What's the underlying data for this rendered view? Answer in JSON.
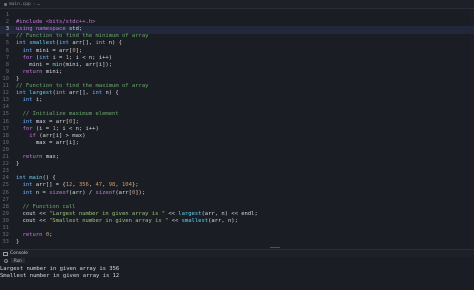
{
  "breadcrumb": {
    "file": "main.cpp",
    "separator": "›",
    "trail": "…"
  },
  "editor": {
    "active_line": 3,
    "lines": [
      {
        "n": "1",
        "tokens": []
      },
      {
        "n": "2",
        "tokens": [
          [
            "pp",
            "#include <bits/stdc++.h>"
          ]
        ]
      },
      {
        "n": "3",
        "tokens": [
          [
            "kw",
            "using namespace "
          ],
          [
            "pl",
            "std;"
          ]
        ]
      },
      {
        "n": "4",
        "tokens": [
          [
            "cm",
            "// Function to find the minimum of array"
          ]
        ]
      },
      {
        "n": "5",
        "tokens": [
          [
            "ty",
            "int "
          ],
          [
            "fn",
            "smallest"
          ],
          [
            "pl",
            "("
          ],
          [
            "ty",
            "int "
          ],
          [
            "pl",
            "arr[], "
          ],
          [
            "ty",
            "int "
          ],
          [
            "pl",
            "n) {"
          ]
        ]
      },
      {
        "n": "6",
        "tokens": [
          [
            "pl",
            "  "
          ],
          [
            "ty",
            "int "
          ],
          [
            "pl",
            "mini = arr["
          ],
          [
            "nu",
            "0"
          ],
          [
            "pl",
            "];"
          ]
        ]
      },
      {
        "n": "7",
        "tokens": [
          [
            "pl",
            "  "
          ],
          [
            "kw",
            "for "
          ],
          [
            "pl",
            "("
          ],
          [
            "ty",
            "int "
          ],
          [
            "pl",
            "i = "
          ],
          [
            "nu",
            "1"
          ],
          [
            "pl",
            "; i < n; i++)"
          ]
        ]
      },
      {
        "n": "8",
        "tokens": [
          [
            "pl",
            "    mini = "
          ],
          [
            "fn",
            "min"
          ],
          [
            "pl",
            "(mini, arr[i]);"
          ]
        ]
      },
      {
        "n": "9",
        "tokens": [
          [
            "pl",
            "  "
          ],
          [
            "kw",
            "return "
          ],
          [
            "pl",
            "mini;"
          ]
        ]
      },
      {
        "n": "10",
        "tokens": [
          [
            "pl",
            "}"
          ]
        ]
      },
      {
        "n": "11",
        "tokens": [
          [
            "cm",
            "// Function to find the maximum of array"
          ]
        ]
      },
      {
        "n": "12",
        "tokens": [
          [
            "ty",
            "int "
          ],
          [
            "fn",
            "largest"
          ],
          [
            "pl",
            "("
          ],
          [
            "ty",
            "int "
          ],
          [
            "pl",
            "arr[], "
          ],
          [
            "ty",
            "int "
          ],
          [
            "pl",
            "n) {"
          ]
        ]
      },
      {
        "n": "13",
        "tokens": [
          [
            "pl",
            "  "
          ],
          [
            "ty",
            "int "
          ],
          [
            "pl",
            "i;"
          ]
        ]
      },
      {
        "n": "14",
        "tokens": []
      },
      {
        "n": "15",
        "tokens": [
          [
            "pl",
            "  "
          ],
          [
            "cm",
            "// Initialize maximum element"
          ]
        ]
      },
      {
        "n": "16",
        "tokens": [
          [
            "pl",
            "  "
          ],
          [
            "ty",
            "int "
          ],
          [
            "pl",
            "max = arr["
          ],
          [
            "nu",
            "0"
          ],
          [
            "pl",
            "];"
          ]
        ]
      },
      {
        "n": "17",
        "tokens": [
          [
            "pl",
            "  "
          ],
          [
            "kw",
            "for "
          ],
          [
            "pl",
            "(i = "
          ],
          [
            "nu",
            "1"
          ],
          [
            "pl",
            "; i < n; i++)"
          ]
        ]
      },
      {
        "n": "18",
        "tokens": [
          [
            "pl",
            "    "
          ],
          [
            "kw",
            "if "
          ],
          [
            "pl",
            "(arr[i] > max)"
          ]
        ]
      },
      {
        "n": "19",
        "tokens": [
          [
            "pl",
            "      max = arr[i];"
          ]
        ]
      },
      {
        "n": "20",
        "tokens": []
      },
      {
        "n": "21",
        "tokens": [
          [
            "pl",
            "  "
          ],
          [
            "kw",
            "return "
          ],
          [
            "pl",
            "max;"
          ]
        ]
      },
      {
        "n": "22",
        "tokens": [
          [
            "pl",
            "}"
          ]
        ]
      },
      {
        "n": "23",
        "tokens": []
      },
      {
        "n": "24",
        "tokens": [
          [
            "ty",
            "int "
          ],
          [
            "fn",
            "main"
          ],
          [
            "pl",
            "() {"
          ]
        ]
      },
      {
        "n": "25",
        "tokens": [
          [
            "pl",
            "  "
          ],
          [
            "ty",
            "int "
          ],
          [
            "pl",
            "arr[] = {"
          ],
          [
            "nu",
            "12"
          ],
          [
            "pl",
            ", "
          ],
          [
            "nu",
            "356"
          ],
          [
            "pl",
            ", "
          ],
          [
            "nu",
            "47"
          ],
          [
            "pl",
            ", "
          ],
          [
            "nu",
            "98"
          ],
          [
            "pl",
            ", "
          ],
          [
            "nu",
            "104"
          ],
          [
            "pl",
            "};"
          ]
        ]
      },
      {
        "n": "26",
        "tokens": [
          [
            "pl",
            "  "
          ],
          [
            "ty",
            "int "
          ],
          [
            "pl",
            "n = "
          ],
          [
            "kw",
            "sizeof"
          ],
          [
            "pl",
            "(arr) / "
          ],
          [
            "kw",
            "sizeof"
          ],
          [
            "pl",
            "(arr["
          ],
          [
            "nu",
            "0"
          ],
          [
            "pl",
            "]);"
          ]
        ]
      },
      {
        "n": "27",
        "tokens": []
      },
      {
        "n": "28",
        "tokens": [
          [
            "pl",
            "  "
          ],
          [
            "cm",
            "// Function call"
          ]
        ]
      },
      {
        "n": "29",
        "tokens": [
          [
            "pl",
            "  cout << "
          ],
          [
            "st",
            "\"Largest number in given array is \""
          ],
          [
            "pl",
            " << "
          ],
          [
            "fn",
            "largest"
          ],
          [
            "pl",
            "(arr, n) << endl;"
          ]
        ]
      },
      {
        "n": "30",
        "tokens": [
          [
            "pl",
            "  cout << "
          ],
          [
            "st",
            "\"Smallest number in given array is \""
          ],
          [
            "pl",
            " << "
          ],
          [
            "fn",
            "smallest"
          ],
          [
            "pl",
            "(arr, n);"
          ]
        ]
      },
      {
        "n": "31",
        "tokens": []
      },
      {
        "n": "32",
        "tokens": [
          [
            "pl",
            "  "
          ],
          [
            "kw",
            "return "
          ],
          [
            "nu",
            "0"
          ],
          [
            "pl",
            ";"
          ]
        ]
      },
      {
        "n": "33",
        "tokens": [
          [
            "pl",
            "}"
          ]
        ]
      }
    ]
  },
  "console": {
    "tab_label": "Console",
    "run_label": "Run",
    "output": [
      "Largest number in given array is 356",
      "Smallest number in given array is 12"
    ]
  },
  "colors": {
    "keyword": "#c678dd",
    "type": "#6eb6ff",
    "function": "#5fd3f3",
    "string": "#98c379",
    "number": "#d19a66",
    "comment": "#6aa86a",
    "background": "#1b1d24"
  }
}
